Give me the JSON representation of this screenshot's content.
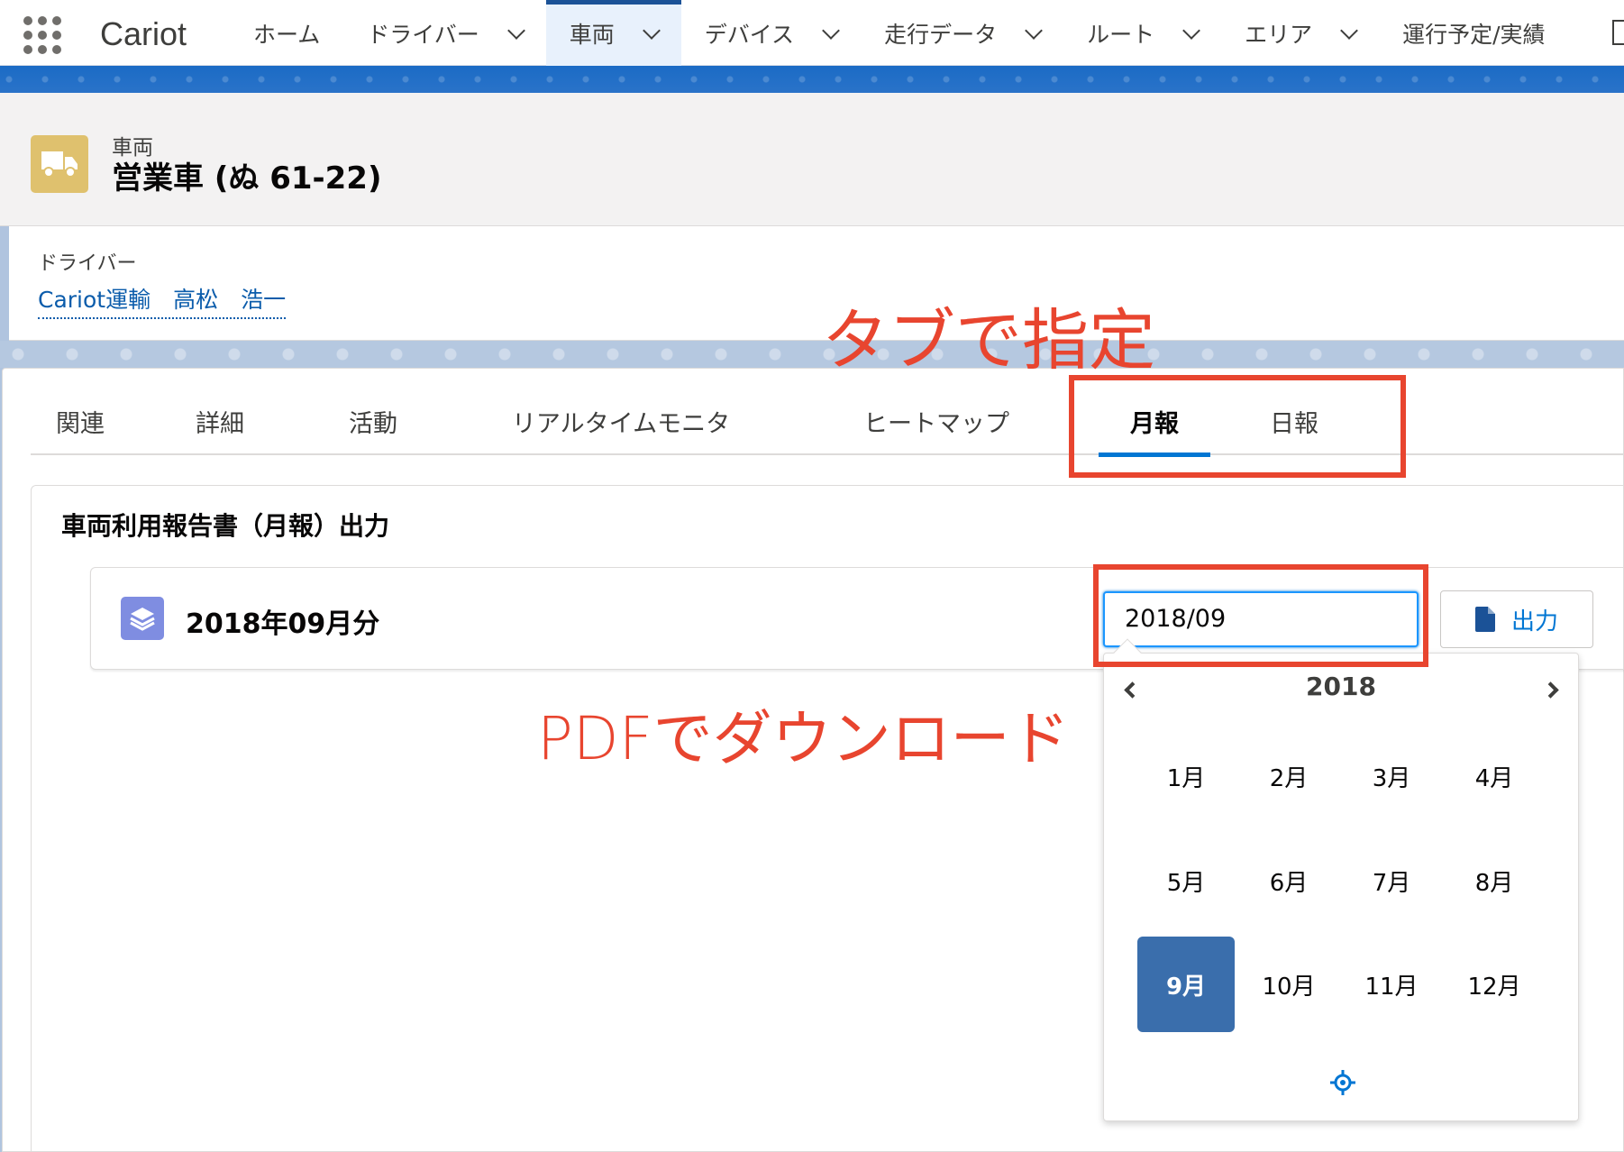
{
  "app": {
    "name": "Cariot"
  },
  "nav": {
    "items": [
      {
        "label": "ホーム",
        "dropdown": false,
        "active": false
      },
      {
        "label": "ドライバー",
        "dropdown": true,
        "active": false
      },
      {
        "label": "車両",
        "dropdown": true,
        "active": true
      },
      {
        "label": "デバイス",
        "dropdown": true,
        "active": false
      },
      {
        "label": "走行データ",
        "dropdown": true,
        "active": false
      },
      {
        "label": "ルート",
        "dropdown": true,
        "active": false
      },
      {
        "label": "エリア",
        "dropdown": true,
        "active": false
      },
      {
        "label": "運行予定/実績",
        "dropdown": false,
        "active": false
      }
    ]
  },
  "record": {
    "object_type": "車両",
    "title": "営業車 (ぬ 61-22)",
    "icon": "truck-icon",
    "field_label": "ドライバー",
    "field_value": "Cariot運輸　高松　浩一"
  },
  "tabs": [
    {
      "label": "関連",
      "active": false
    },
    {
      "label": "詳細",
      "active": false
    },
    {
      "label": "活動",
      "active": false
    },
    {
      "label": "リアルタイムモニタ",
      "active": false
    },
    {
      "label": "ヒートマップ",
      "active": false
    },
    {
      "label": "月報",
      "active": true
    },
    {
      "label": "日報",
      "active": false
    }
  ],
  "report": {
    "card_title": "車両利用報告書（月報）出力",
    "row_label": "2018年09月分",
    "row_icon": "layers-icon",
    "month_value": "2018/09",
    "output_label": "出力",
    "output_icon": "file-icon"
  },
  "datepicker": {
    "year": "2018",
    "months": [
      "1月",
      "2月",
      "3月",
      "4月",
      "5月",
      "6月",
      "7月",
      "8月",
      "9月",
      "10月",
      "11月",
      "12月"
    ],
    "selected_index": 8,
    "today_icon": "crosshair-icon"
  },
  "annotations": {
    "tab_note": "タブで指定",
    "pdf_note": "PDFでダウンロード",
    "color": "#e8452f"
  },
  "colors": {
    "brand_blue": "#1b6bc5",
    "link": "#0b5cab",
    "accent": "#0176d3",
    "selected_month": "#3a6eac",
    "vehicle_icon_bg": "#dfc16e",
    "report_icon_bg": "#7f8de1"
  }
}
